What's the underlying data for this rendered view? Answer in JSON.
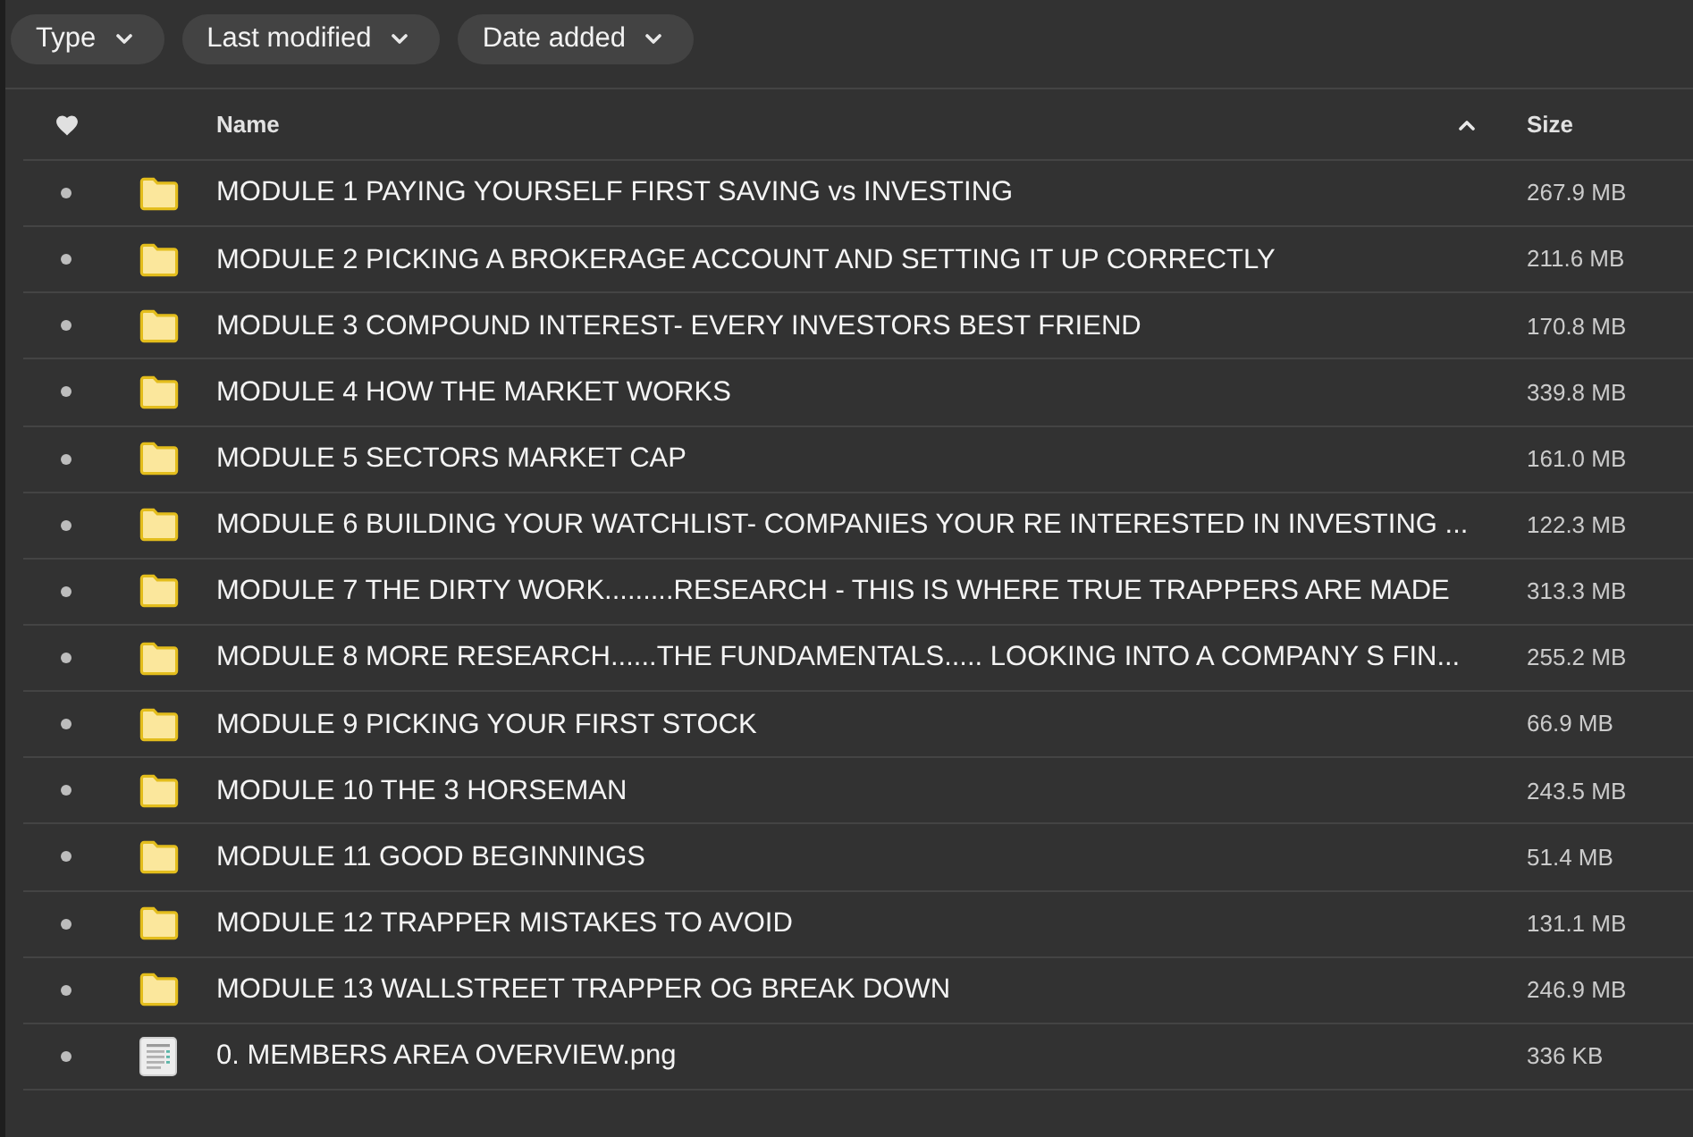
{
  "filters": [
    {
      "label": "Type"
    },
    {
      "label": "Last modified"
    },
    {
      "label": "Date added"
    }
  ],
  "table": {
    "columns": [
      {
        "label": "Name",
        "sorted": true
      },
      {
        "label": "Size",
        "sorted": false
      }
    ],
    "rows": [
      {
        "kind": "folder",
        "favorite": false,
        "name": "MODULE 1 PAYING YOURSELF FIRST SAVING vs INVESTING",
        "size": "267.9 MB"
      },
      {
        "kind": "folder",
        "favorite": false,
        "name": "MODULE 2 PICKING A BROKERAGE ACCOUNT AND SETTING IT UP CORRECTLY",
        "size": "211.6 MB"
      },
      {
        "kind": "folder",
        "favorite": false,
        "name": "MODULE 3 COMPOUND INTEREST- EVERY INVESTORS BEST FRIEND",
        "size": "170.8 MB"
      },
      {
        "kind": "folder",
        "favorite": false,
        "name": "MODULE 4 HOW THE MARKET WORKS",
        "size": "339.8 MB"
      },
      {
        "kind": "folder",
        "favorite": false,
        "name": "MODULE 5 SECTORS MARKET CAP",
        "size": "161.0 MB"
      },
      {
        "kind": "folder",
        "favorite": false,
        "name": "MODULE 6 BUILDING YOUR WATCHLIST- COMPANIES YOUR RE INTERESTED IN INVESTING ...",
        "size": "122.3 MB"
      },
      {
        "kind": "folder",
        "favorite": false,
        "name": "MODULE 7 THE DIRTY WORK.........RESEARCH - THIS IS WHERE TRUE TRAPPERS ARE MADE",
        "size": "313.3 MB"
      },
      {
        "kind": "folder",
        "favorite": false,
        "name": "MODULE 8 MORE RESEARCH......THE FUNDAMENTALS..... LOOKING INTO A COMPANY S FIN...",
        "size": "255.2 MB"
      },
      {
        "kind": "folder",
        "favorite": false,
        "name": "MODULE 9 PICKING YOUR FIRST STOCK",
        "size": "66.9 MB"
      },
      {
        "kind": "folder",
        "favorite": false,
        "name": "MODULE 10 THE 3 HORSEMAN",
        "size": "243.5 MB"
      },
      {
        "kind": "folder",
        "favorite": false,
        "name": "MODULE 11 GOOD BEGINNINGS",
        "size": "51.4 MB"
      },
      {
        "kind": "folder",
        "favorite": false,
        "name": "MODULE 12 TRAPPER MISTAKES TO AVOID",
        "size": "131.1 MB"
      },
      {
        "kind": "folder",
        "favorite": false,
        "name": "MODULE 13 WALLSTREET TRAPPER OG BREAK DOWN",
        "size": "246.9 MB"
      },
      {
        "kind": "image",
        "favorite": false,
        "name": "0. MEMBERS AREA OVERVIEW.png",
        "size": "336 KB"
      }
    ]
  }
}
